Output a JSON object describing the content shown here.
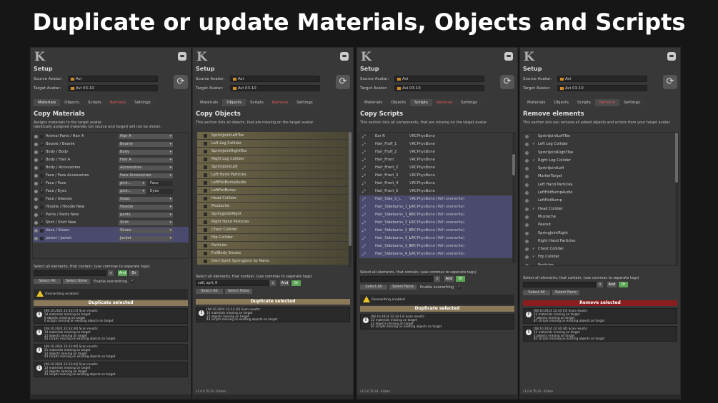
{
  "headline": "Duplicate or update Materials, Objects and Scripts",
  "common": {
    "setup": "Setup",
    "source_label": "Source Avatar:",
    "target_label": "Target Avatar:",
    "source_value": "Avi",
    "target_value": "Avi 03.10",
    "tabs": [
      "Materials",
      "Objects",
      "Scripts",
      "Remove",
      "Settings"
    ],
    "filter_label": "Select all elements, that contain: (use commas to seperate tags)",
    "x": "x",
    "and": "And",
    "or": "Or",
    "select_all": "Select All",
    "select_none": "Select None",
    "enable_overwriting": "Enable overwriting",
    "overwriting_enabled": "Overwriting enabled",
    "colors": {
      "accent_gold": "#8a7a5a",
      "remove_red": "#8a1d1d",
      "and_green": "#5aa455",
      "warn_yellow": "#e8c32a"
    }
  },
  "materials": {
    "title": "Copy Materials",
    "desc1": "Assigns materials to the target avatar.",
    "desc2": "Identically assigned materials (on source and target) will not be shown.",
    "rows": [
      {
        "name": "Animal Parts / Hair A",
        "val": "Hair A",
        "chk": ""
      },
      {
        "name": "Beanie / Beanie",
        "val": "Beanie",
        "chk": "✓"
      },
      {
        "name": "Body / Body",
        "val": "Body",
        "chk": "✓"
      },
      {
        "name": "Body / Hair A",
        "val": "Hair A",
        "chk": "✓"
      },
      {
        "name": "Body / Accessoires",
        "val": "Accessoires",
        "chk": ""
      },
      {
        "name": "Face / Face Accessoires",
        "val": "Face Accessoires",
        "chk": ""
      },
      {
        "name": "Face / Face",
        "val": "pick...",
        "val2": "Face",
        "chk": "✓"
      },
      {
        "name": "Face / Eyes",
        "val": "pick...",
        "val2": "Eyes",
        "chk": "✓"
      },
      {
        "name": "Face / Glasses",
        "val": "Glass",
        "chk": ""
      },
      {
        "name": "Hoodie / Hoodie New",
        "val": "Hoodie",
        "chk": ""
      },
      {
        "name": "Pants / Pants New",
        "val": "pants",
        "chk": "✓"
      },
      {
        "name": "Shirt / Shirt New",
        "val": "Shirt",
        "chk": "✓"
      },
      {
        "name": "Vans / Shoes",
        "val": "Shoes",
        "chk": ""
      },
      {
        "name": "Jacket / Jacket",
        "val": "Jacket",
        "chk": ""
      }
    ],
    "action": "Duplicate selected",
    "logs": [
      {
        "ts": "[08.10.2024 22:33:15] Scan results:",
        "l1": "14 materials missing on target",
        "l2": "0 objects missing on target",
        "l3": "0 scripts missing on existing objects on target"
      },
      {
        "ts": "[08.10.2024 22:33:30] Scan results:",
        "l1": "14 materials missing on target",
        "l2": "22 objects missing on target",
        "l3": "43 scripts missing on existing objects on target"
      },
      {
        "ts": "[08.10.2024 22:33:40] Scan results:",
        "l1": "21 materials missing on target",
        "l2": "22 objects missing on target",
        "l3": "43 scripts missing on existing objects on target"
      },
      {
        "ts": "[08.10.2024 22:33:44] Scan results:",
        "l1": "14 materials missing on target",
        "l2": "22 objects missing on target",
        "l3": "43 scripts missing on existing objects on target"
      }
    ]
  },
  "objects": {
    "title": "Copy Objects",
    "desc1": "This section lists all objects, that are missing on the target avatar.",
    "rows": [
      "SprintJointLeftToe",
      "Left Leg Collider",
      "SprintJointRightToe",
      "Right Leg Collider",
      "SprintJointLeft",
      "Left Hand Particles",
      "LeftFistBumpAudio",
      "LeftFistBump",
      "Head Collider",
      "Mustache",
      "SpringJointRight",
      "Right Hand Particles",
      "Chest Collider",
      "Hip Collider",
      "Particles",
      "FullBody Smoke",
      "Dani Spirit Springjoint by Raivo"
    ],
    "filter_value": "coll, sprl, fi",
    "action": "Duplicate selected",
    "logs": [
      {
        "ts": "[08.10.2024 22:33:30] Scan results:",
        "l1": "14 materials missing on target",
        "l2": "22 objects missing on target",
        "l3": "43 scripts missing on existing objects on target"
      }
    ],
    "footer": "v1.0.6 T6.24 - Kirban"
  },
  "scripts": {
    "title": "Copy Scripts",
    "desc1": "This section lists all components, that are missing on the target avatar.",
    "rows": [
      {
        "name": "Ear R",
        "type": "VRCPhysBone"
      },
      {
        "name": "Hair_Fluff_1",
        "type": "VRCPhysBone"
      },
      {
        "name": "Hair_Fluff_2",
        "type": "VRCPhysBone"
      },
      {
        "name": "Hair_Front",
        "type": "VRCPhysBone"
      },
      {
        "name": "Hair_Front_2",
        "type": "VRCPhysBone"
      },
      {
        "name": "Hair_Front_3",
        "type": "VRCPhysBone"
      },
      {
        "name": "Hair_Front_4",
        "type": "VRCPhysBone"
      },
      {
        "name": "Hair_Front_5",
        "type": "VRCPhysBone"
      },
      {
        "name": "Hair_Side_3_L",
        "type": "VRCPhysBone (Will overwrite)"
      },
      {
        "name": "Hair_Sideburns_1_L",
        "type": "VRCPhysBone (Will overwrite)"
      },
      {
        "name": "Hair_Sideburns_1_R",
        "type": "VRCPhysBone (Will overwrite)"
      },
      {
        "name": "Hair_Sideburns_2_L",
        "type": "VRCPhysBone (Will overwrite)"
      },
      {
        "name": "Hair_Sideburns_2_R",
        "type": "VRCPhysBone (Will overwrite)"
      },
      {
        "name": "Hair_Sideburns_3_L",
        "type": "VRCPhysBone (Will overwrite)"
      },
      {
        "name": "Hair_Sideburns_3_R",
        "type": "VRCPhysBone (Will overwrite)"
      },
      {
        "name": "Hair_Sideburns_4_L",
        "type": "VRCPhysBone (Will overwrite)"
      }
    ],
    "action": "Duplicate selected",
    "logs": [
      {
        "ts": "[08.10.2024 22:34:13] Scan results:",
        "l1": "22 materials missing on target",
        "l2": "21 objects missing on target",
        "l3": "87 scripts missing on existing objects on target"
      }
    ],
    "footer": "v1.0.6 T6.24 - Kirban"
  },
  "remove": {
    "title": "Remove elements",
    "desc1": "This section lets you remove all added objects and scripts from your target avatar",
    "rows": [
      {
        "name": "SprintJointLeftToe",
        "chk": ""
      },
      {
        "name": "Left Leg Collider",
        "chk": "✓"
      },
      {
        "name": "SprintJointRightToe",
        "chk": ""
      },
      {
        "name": "Right Leg Collider",
        "chk": "✓"
      },
      {
        "name": "SprintJointLeft",
        "chk": ""
      },
      {
        "name": "MarkerTarget",
        "chk": ""
      },
      {
        "name": "Left Hand Particles",
        "chk": ""
      },
      {
        "name": "LeftFistBumpAudio",
        "chk": ""
      },
      {
        "name": "LeftFistBump",
        "chk": ""
      },
      {
        "name": "Head Collider",
        "chk": "✓"
      },
      {
        "name": "Mustache",
        "chk": ""
      },
      {
        "name": "Peanut",
        "chk": ""
      },
      {
        "name": "SpringJointRight",
        "chk": ""
      },
      {
        "name": "Right Hand Particles",
        "chk": ""
      },
      {
        "name": "Chest Collider",
        "chk": "✓"
      },
      {
        "name": "Hip Collider",
        "chk": "✓"
      },
      {
        "name": "Particles",
        "chk": ""
      }
    ],
    "action": "Remove selected",
    "logs": [
      {
        "ts": "[08.10.2024 22:34:15] Scan results:",
        "l1": "23 materials missing on target",
        "l2": "7 objects missing on target",
        "l3": "87 scripts missing on existing objects on target"
      },
      {
        "ts": "[08.10.2024 22:34:34] Scan results:",
        "l1": "12 materials missing on target",
        "l2": "2 objects missing on target",
        "l3": "85 scripts missing on existing objects on target"
      }
    ],
    "footer": "v1.0.6 T6.24 - Kirban"
  }
}
